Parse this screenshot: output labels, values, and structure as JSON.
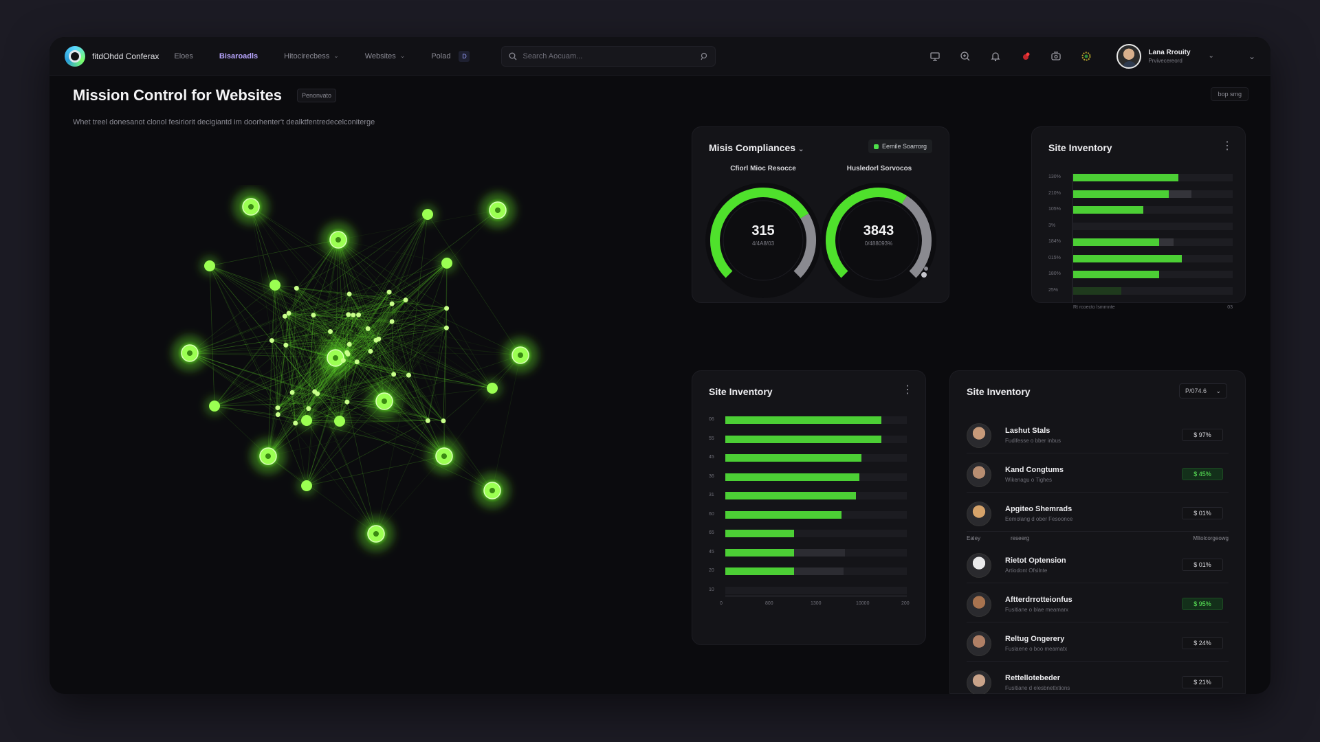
{
  "topbar": {
    "brand": "fitdOhdd Conferax",
    "nav": [
      {
        "label": "Eloes",
        "chevron": false,
        "active": false
      },
      {
        "label": "Bisaroadls",
        "chevron": false,
        "active": true
      },
      {
        "label": "Hitocirecbess",
        "chevron": true,
        "active": false
      },
      {
        "label": "Websites",
        "chevron": true,
        "active": false
      },
      {
        "label": "Polad",
        "chevron": false,
        "active": false,
        "badge": "D"
      }
    ],
    "search_placeholder": "Search Aocuam...",
    "user": {
      "name": "Lana Rrouity",
      "subtitle": "Prvivecereord"
    }
  },
  "header": {
    "title": "Mission Control for Websites",
    "badge": "Penonvato",
    "subtitle": "Whet treel donesanot clonol fesiriorit decigiantd im doorhenter't dealktfentredecelconiterge",
    "right_button": "bop smg"
  },
  "compliance": {
    "title": "Misis Compliances",
    "pill": "Eemile Soarrorg",
    "gauges": [
      {
        "label": "Cfiorl Mioc Resocce",
        "value": "315",
        "sub": "4/4A8/03",
        "fraction": 0.72
      },
      {
        "label": "Husledorl Sorvocos",
        "value": "3843",
        "sub": "0/488093%",
        "fraction": 0.62
      }
    ]
  },
  "inventory_small": {
    "title": "Site Inventory",
    "ticks": [
      "130%",
      "210%",
      "105%",
      "3%",
      "184%",
      "015%",
      "180%",
      "25%"
    ],
    "bars": [
      {
        "value": 0.66,
        "track": 0.66
      },
      {
        "value": 0.6,
        "track": 0.74
      },
      {
        "value": 0.44,
        "track": 0.44
      },
      {
        "value": 0.0,
        "track": 0.0
      },
      {
        "value": 0.54,
        "track": 0.63
      },
      {
        "value": 0.68,
        "track": 0.68
      },
      {
        "value": 0.54,
        "track": 0.54
      },
      {
        "value": 0.0,
        "track": 0.3
      }
    ],
    "footer_left": "Rt rcoecto lsmrnnte",
    "footer_right": "03"
  },
  "inventory_mid": {
    "title": "Site Inventory",
    "ticks": [
      "06",
      "55",
      "45",
      "36",
      "31",
      "60",
      "65",
      "45",
      "20",
      "10"
    ],
    "xticks": [
      "0",
      "800",
      "1300",
      "10000",
      "200"
    ],
    "bars": [
      {
        "value": 0.86,
        "track": 0.86
      },
      {
        "value": 0.86,
        "track": 0.86
      },
      {
        "value": 0.75,
        "track": 0.75
      },
      {
        "value": 0.74,
        "track": 0.74
      },
      {
        "value": 0.72,
        "track": 0.72
      },
      {
        "value": 0.64,
        "track": 0.64
      },
      {
        "value": 0.38,
        "track": 0.38
      },
      {
        "value": 0.38,
        "track": 0.66
      },
      {
        "value": 0.38,
        "track": 0.65
      },
      {
        "value": 0.0,
        "track": 0.0
      }
    ]
  },
  "inventory_list": {
    "title": "Site Inventory",
    "dropdown": "P/074.6",
    "separator": {
      "left": "Ealey",
      "mid": "reseerg",
      "right": "Mltolcorgeowg"
    },
    "rows": [
      {
        "name": "Lashut Stals",
        "sub": "Fudifesse o bber inbus",
        "value": "$  97%",
        "highlight": false,
        "tone": "#c79a7a"
      },
      {
        "name": "Kand Congtums",
        "sub": "Wikenagu o Tighes",
        "value": "$  45%",
        "highlight": true,
        "tone": "#b88e72"
      },
      {
        "name": "Apgiteo Shemrads",
        "sub": "Eemolang d ober Fesoonce",
        "value": "$  01%",
        "highlight": false,
        "tone": "#d6a36a"
      },
      {
        "name": "Rietot Optension",
        "sub": "Artiodont Ofsilnte",
        "value": "$  01%",
        "highlight": false,
        "tone": "#e9e9ea"
      },
      {
        "name": "Aftterdrrotteionfus",
        "sub": "Fusitiane o blae meamarx",
        "value": "$  95%",
        "highlight": true,
        "tone": "#a8734f"
      },
      {
        "name": "Reltug Ongerery",
        "sub": "Fuslaene o boo meamatx",
        "value": "$  24%",
        "highlight": false,
        "tone": "#b08066"
      },
      {
        "name": "Rettellotebeder",
        "sub": "Fusitiane d elesbnetlxtions",
        "value": "$  21%",
        "highlight": false,
        "tone": "#c9a38a"
      }
    ]
  }
}
